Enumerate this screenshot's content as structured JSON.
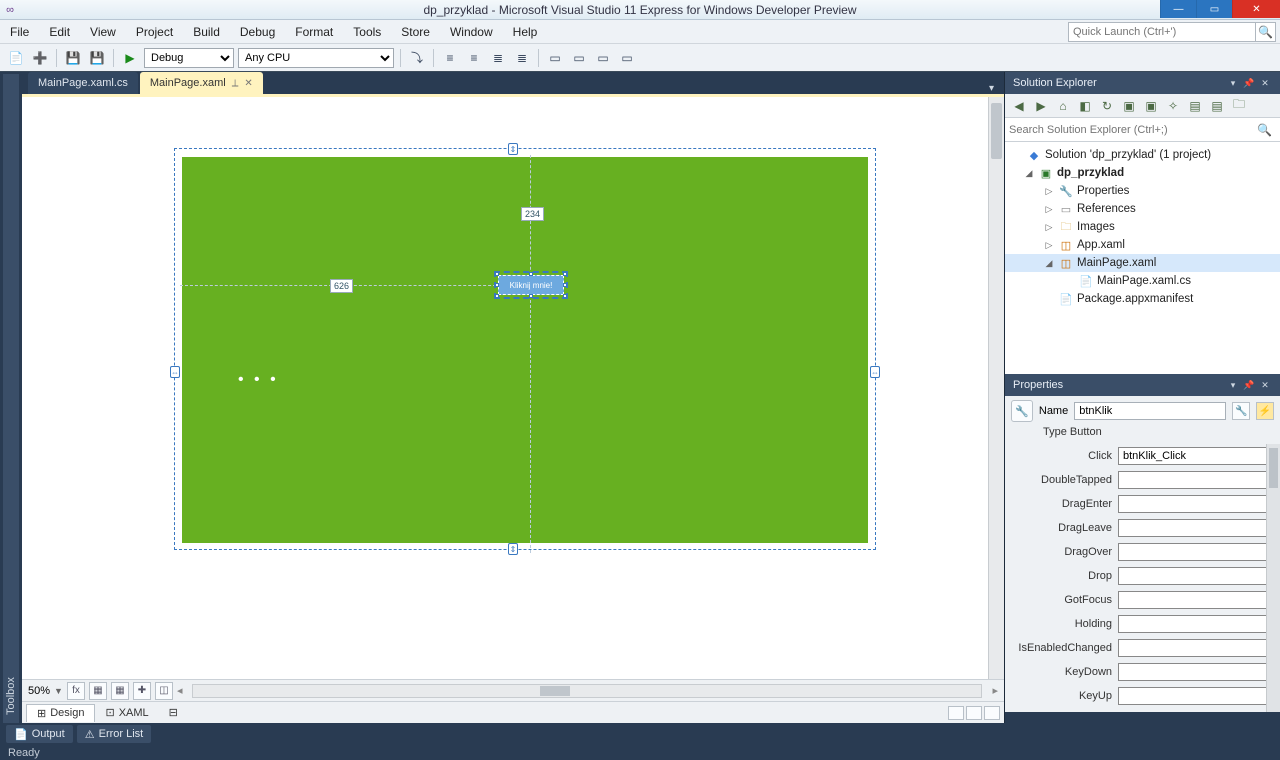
{
  "title": "dp_przyklad - Microsoft Visual Studio 11 Express for Windows Developer Preview",
  "menu": [
    "File",
    "Edit",
    "View",
    "Project",
    "Build",
    "Debug",
    "Format",
    "Tools",
    "Store",
    "Window",
    "Help"
  ],
  "quicklaunch_placeholder": "Quick Launch (Ctrl+')",
  "toolbar": {
    "config": "Debug",
    "platform": "Any CPU"
  },
  "toolbox_tab": "Toolbox",
  "tabs": [
    {
      "label": "MainPage.xaml.cs",
      "active": false
    },
    {
      "label": "MainPage.xaml",
      "active": true
    }
  ],
  "designer": {
    "button_text": "Kliknij mnie!",
    "meas_h": "626",
    "meas_v": "234",
    "zoom": "50%",
    "view_tabs": {
      "design": "Design",
      "xaml": "XAML"
    }
  },
  "solution_explorer": {
    "title": "Solution Explorer",
    "search_placeholder": "Search Solution Explorer (Ctrl+;)",
    "sln": "Solution 'dp_przyklad' (1 project)",
    "proj": "dp_przyklad",
    "nodes": {
      "properties": "Properties",
      "references": "References",
      "images": "Images",
      "app": "App.xaml",
      "main": "MainPage.xaml",
      "maincs": "MainPage.xaml.cs",
      "pkg": "Package.appxmanifest"
    }
  },
  "properties": {
    "title": "Properties",
    "name_label": "Name",
    "name_value": "btnKlik",
    "type_label": "Type",
    "type_value": "Button",
    "events": [
      {
        "label": "Click",
        "value": "btnKlik_Click"
      },
      {
        "label": "DoubleTapped",
        "value": ""
      },
      {
        "label": "DragEnter",
        "value": ""
      },
      {
        "label": "DragLeave",
        "value": ""
      },
      {
        "label": "DragOver",
        "value": ""
      },
      {
        "label": "Drop",
        "value": ""
      },
      {
        "label": "GotFocus",
        "value": ""
      },
      {
        "label": "Holding",
        "value": ""
      },
      {
        "label": "IsEnabledChanged",
        "value": ""
      },
      {
        "label": "KeyDown",
        "value": ""
      },
      {
        "label": "KeyUp",
        "value": ""
      }
    ]
  },
  "bottom_tabs": {
    "output": "Output",
    "errors": "Error List"
  },
  "status": "Ready"
}
